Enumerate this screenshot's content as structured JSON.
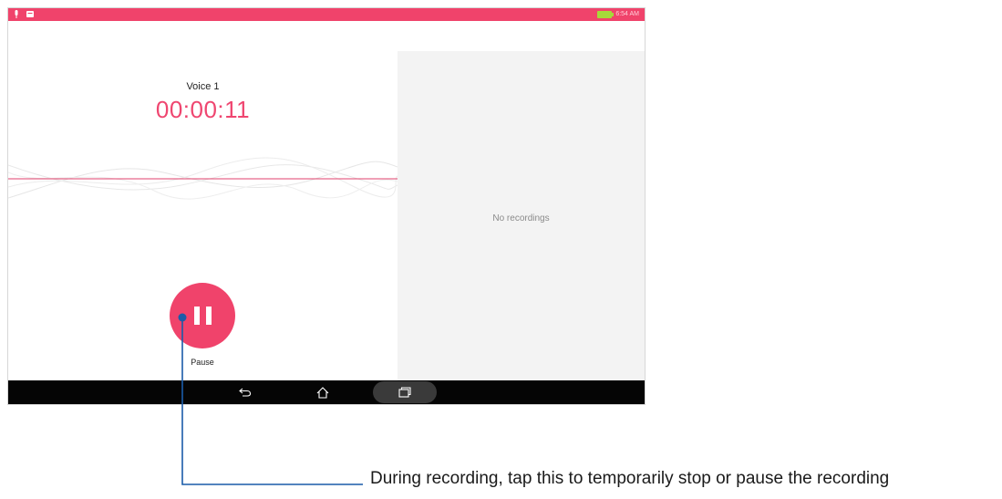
{
  "status_bar": {
    "time": "6:54 AM",
    "left_icons": [
      "microphone-icon",
      "message-icon"
    ],
    "battery": "battery-charging-icon"
  },
  "recorder": {
    "title": "Voice 1",
    "timer": "00:00:11",
    "pause_label": "Pause",
    "accent_color": "#f0436b"
  },
  "recordings_panel": {
    "empty_text": "No recordings"
  },
  "navigation": {
    "icons": [
      "back-icon",
      "home-icon",
      "recent-apps-icon"
    ]
  },
  "callout": {
    "text": "During recording, tap this to temporarily stop or pause the recording",
    "line_color": "#1a5ca8"
  }
}
